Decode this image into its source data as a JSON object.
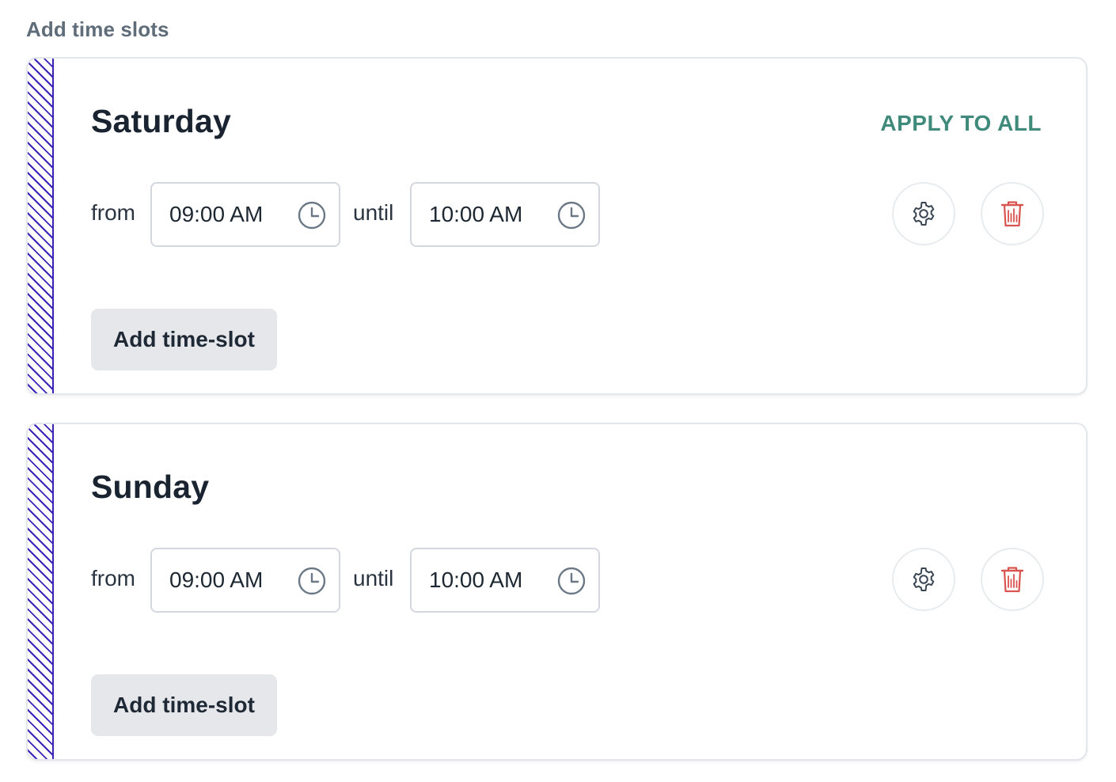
{
  "section": {
    "title": "Add time slots"
  },
  "days": [
    {
      "name": "Saturday",
      "apply_to_all": "APPLY TO ALL",
      "from_label": "from",
      "from_value": "09:00 AM",
      "until_label": "until",
      "until_value": "10:00 AM",
      "add_button": "Add time-slot"
    },
    {
      "name": "Sunday",
      "from_label": "from",
      "from_value": "09:00 AM",
      "until_label": "until",
      "until_value": "10:00 AM",
      "add_button": "Add time-slot"
    }
  ],
  "icons": {
    "clock": "clock-icon",
    "settings": "gear-icon",
    "delete": "trash-icon"
  },
  "colors": {
    "accent": "#3f8a7b",
    "hatch": "#3b23b8",
    "danger": "#d9534f",
    "button_bg": "#e5e7ea"
  }
}
